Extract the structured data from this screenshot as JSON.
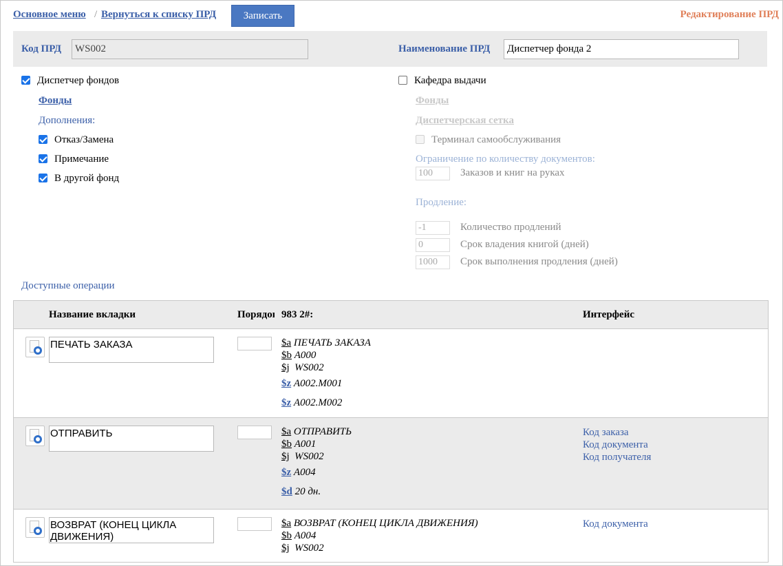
{
  "nav": {
    "main_menu": "Основное меню",
    "separator": "/",
    "back_to_list": "Вернуться к списку ПРД",
    "save_label": "Записать",
    "page_title": "Редактирование ПРД"
  },
  "header": {
    "code_label": "Код ПРД",
    "code_value": "WS002",
    "name_label": "Наименование ПРД",
    "name_value": "Диспетчер фонда 2"
  },
  "left": {
    "dispatcher_label": "Диспетчер фондов",
    "dispatcher_checked": true,
    "funds_link": "Фонды",
    "additions_label": "Дополнения:",
    "options": [
      {
        "label": "Отказ/Замена",
        "checked": true
      },
      {
        "label": "Примечание",
        "checked": true
      },
      {
        "label": "В другой фонд",
        "checked": true
      }
    ]
  },
  "right": {
    "desk_label": "Кафедра выдачи",
    "desk_checked": false,
    "funds_link": "Фонды",
    "grid_link": "Диспетчерская сетка",
    "terminal_label": "Терминал самообслуживания",
    "limit_label": "Ограничение по количеству документов:",
    "limit_value": "100",
    "limit_desc": "Заказов и книг на руках",
    "renewal_label": "Продление:",
    "renewals": [
      {
        "value": "-1",
        "desc": "Количество продлений"
      },
      {
        "value": "0",
        "desc": "Срок владения книгой (дней)"
      },
      {
        "value": "1000",
        "desc": "Срок выполнения продления (дней)"
      }
    ]
  },
  "ops": {
    "title": "Доступные операции",
    "columns": {
      "tab_name": "Название вкладки",
      "order": "Порядок",
      "field": "983 2#:",
      "interface": "Интерфейс"
    },
    "rows": [
      {
        "name": "ПЕЧАТЬ ЗАКАЗА",
        "subfields": [
          {
            "code": "$a",
            "value": "ПЕЧАТЬ ЗАКАЗА"
          },
          {
            "code": "$b",
            "value": "А000"
          },
          {
            "code": "$j",
            "value": "WS002"
          }
        ],
        "links": [
          {
            "code": "$z",
            "value": "А002.М001"
          },
          {
            "code": "$z",
            "value": "А002.М002"
          }
        ],
        "interface": []
      },
      {
        "name": "ОТПРАВИТЬ",
        "subfields": [
          {
            "code": "$a",
            "value": "ОТПРАВИТЬ"
          },
          {
            "code": "$b",
            "value": "А001"
          },
          {
            "code": "$j",
            "value": "WS002"
          }
        ],
        "links": [
          {
            "code": "$z",
            "value": "А004"
          },
          {
            "code": "$d",
            "value": "20 дн."
          }
        ],
        "interface": [
          "Код заказа",
          "Код документа",
          "Код получателя"
        ]
      },
      {
        "name": "ВОЗВРАТ (КОНЕЦ ЦИКЛА ДВИЖЕНИЯ)",
        "subfields": [
          {
            "code": "$a",
            "value": "ВОЗВРАТ (КОНЕЦ ЦИКЛА ДВИЖЕНИЯ)"
          },
          {
            "code": "$b",
            "value": "А004"
          },
          {
            "code": "$j",
            "value": "WS002"
          }
        ],
        "links": [],
        "interface": [
          "Код документа"
        ]
      }
    ]
  }
}
